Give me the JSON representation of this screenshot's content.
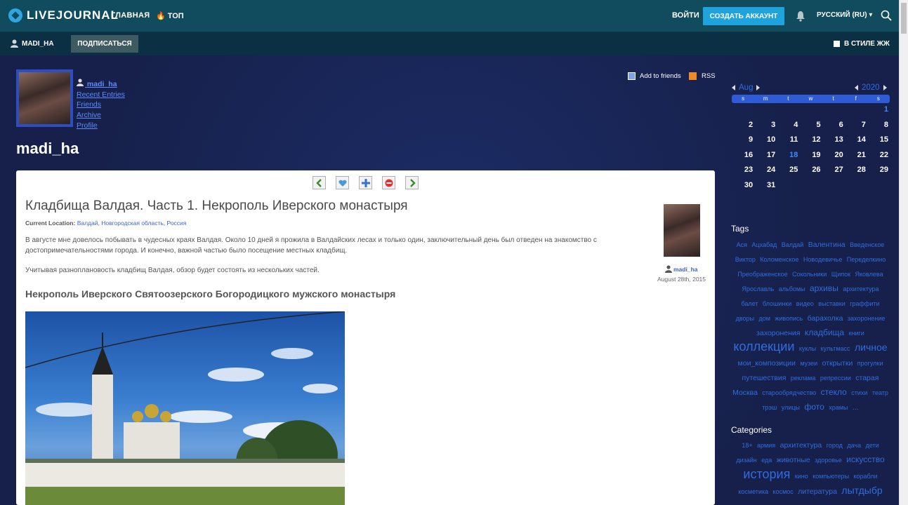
{
  "header": {
    "logo_text": "LIVEJOURNAL",
    "nav_main": "ГЛАВНАЯ",
    "nav_top": "ТОП",
    "login": "ВОЙТИ",
    "create_account": "СОЗДАТЬ АККАУНТ",
    "language": "РУССКИЙ (RU)",
    "language_caret": "▾"
  },
  "subbar": {
    "username": "MADI_HA",
    "subscribe": "ПОДПИСАТЬСЯ",
    "style_toggle": "В СТИЛЕ ЖЖ"
  },
  "profile": {
    "username": "madi_ha",
    "links": [
      "Recent Entries",
      "Friends",
      "Archive",
      "Profile"
    ],
    "journal_title": "madi_ha",
    "add_friends": "Add to friends",
    "rss": "RSS"
  },
  "post": {
    "nav_buttons": [
      "prev",
      "memories",
      "add",
      "flag",
      "next"
    ],
    "title": "Кладбища Валдая. Часть 1. Некрополь Иверского монастыря",
    "location_label": "Current Location:",
    "location_parts": [
      "Валдай",
      "Новгородская область",
      "Россия"
    ],
    "paragraph1": "В августе мне довелось побывать в чудесных краях Валдая. Около 10 дней я прожила в Валдайских лесах и только один, заключительный день был отведен на знакомство с достопримечательностями города. И конечно,  важной частью было посещение местных кладбищ.",
    "paragraph2": "Учитывая разноплановость кладбищ Валдая, обзор будет состоять из нескольких  частей.",
    "subheading": "Некрополь Иверского Святоозерского Богородицкого мужского монастыря",
    "author": "madi_ha",
    "date": "August 28th, 2015"
  },
  "calendar": {
    "month": "Aug",
    "year": "2020",
    "weekdays": [
      "s",
      "m",
      "t",
      "w",
      "t",
      "f",
      "s"
    ],
    "days": [
      "",
      "",
      "",
      "",
      "",
      "",
      "1",
      "2",
      "3",
      "4",
      "5",
      "6",
      "7",
      "8",
      "9",
      "10",
      "11",
      "12",
      "13",
      "14",
      "15",
      "16",
      "17",
      "18",
      "19",
      "20",
      "21",
      "22",
      "23",
      "24",
      "25",
      "26",
      "27",
      "28",
      "29",
      "30",
      "31",
      "",
      "",
      "",
      "",
      ""
    ],
    "highlight": "18"
  },
  "tags": {
    "title": "Tags",
    "items": [
      {
        "t": "Ася",
        "s": 1
      },
      {
        "t": "Ацхабад",
        "s": 1
      },
      {
        "t": "Валдай",
        "s": 1
      },
      {
        "t": "Валентина",
        "s": 2
      },
      {
        "t": "Введенское",
        "s": 1
      },
      {
        "t": "Виктор",
        "s": 1
      },
      {
        "t": "Коломенское",
        "s": 1
      },
      {
        "t": "Новодевичье",
        "s": 1
      },
      {
        "t": "Переделкино",
        "s": 1
      },
      {
        "t": "Преображенское",
        "s": 1
      },
      {
        "t": "Сокольники",
        "s": 1
      },
      {
        "t": "Щипок",
        "s": 1
      },
      {
        "t": "Яковлева",
        "s": 1
      },
      {
        "t": "Ярославль",
        "s": 1
      },
      {
        "t": "альбомы",
        "s": 1
      },
      {
        "t": "архивы",
        "s": 3
      },
      {
        "t": "архитектура",
        "s": 1
      },
      {
        "t": "балет",
        "s": 1
      },
      {
        "t": "блошинки",
        "s": 1
      },
      {
        "t": "видео",
        "s": 1
      },
      {
        "t": "выставки",
        "s": 1
      },
      {
        "t": "граффити",
        "s": 1
      },
      {
        "t": "дворы",
        "s": 1
      },
      {
        "t": "дом",
        "s": 1
      },
      {
        "t": "живопись",
        "s": 1
      },
      {
        "t": "барахолка",
        "s": 2
      },
      {
        "t": "захоронение",
        "s": 1
      },
      {
        "t": "захоронения",
        "s": 2
      },
      {
        "t": "кладбища",
        "s": 3
      },
      {
        "t": "книги",
        "s": 1
      },
      {
        "t": "коллекции",
        "s": 5
      },
      {
        "t": "куклы",
        "s": 1
      },
      {
        "t": "культмасс",
        "s": 1
      },
      {
        "t": "личное",
        "s": 4
      },
      {
        "t": "мои_композиции",
        "s": 2
      },
      {
        "t": "музеи",
        "s": 1
      },
      {
        "t": "открытки",
        "s": 2
      },
      {
        "t": "прогулки",
        "s": 1
      },
      {
        "t": "путешествия",
        "s": 2
      },
      {
        "t": "реклама",
        "s": 1
      },
      {
        "t": "репрессии",
        "s": 1
      },
      {
        "t": "старая",
        "s": 2
      },
      {
        "t": "Москва",
        "s": 2
      },
      {
        "t": "старообрядчество",
        "s": 1
      },
      {
        "t": "стекло",
        "s": 3
      },
      {
        "t": "стихи",
        "s": 1
      },
      {
        "t": "театр",
        "s": 1
      },
      {
        "t": "трэш",
        "s": 1
      },
      {
        "t": "улицы",
        "s": 1
      },
      {
        "t": "фото",
        "s": 3
      },
      {
        "t": "храмы",
        "s": 1
      },
      {
        "t": "...",
        "s": 2
      }
    ]
  },
  "categories": {
    "title": "Categories",
    "items": [
      {
        "t": "18+",
        "s": 1
      },
      {
        "t": "армия",
        "s": 1
      },
      {
        "t": "архитектура",
        "s": 2
      },
      {
        "t": "город",
        "s": 1
      },
      {
        "t": "дача",
        "s": 1
      },
      {
        "t": "дети",
        "s": 1
      },
      {
        "t": "дизайн",
        "s": 1
      },
      {
        "t": "еда",
        "s": 1
      },
      {
        "t": "животные",
        "s": 2
      },
      {
        "t": "здоровье",
        "s": 1
      },
      {
        "t": "искусство",
        "s": 3
      },
      {
        "t": "история",
        "s": 5
      },
      {
        "t": "кино",
        "s": 1
      },
      {
        "t": "компьютеры",
        "s": 1
      },
      {
        "t": "корабли",
        "s": 1
      },
      {
        "t": "косметика",
        "s": 1
      },
      {
        "t": "космос",
        "s": 1
      },
      {
        "t": "литература",
        "s": 2
      },
      {
        "t": "лытдыбр",
        "s": 4
      }
    ]
  },
  "colors": {
    "topbar": "#104b5e",
    "subbar": "#0b2f43",
    "accent": "#1fa3dc",
    "link": "#5c8cff",
    "tag": "#2f6de0"
  }
}
